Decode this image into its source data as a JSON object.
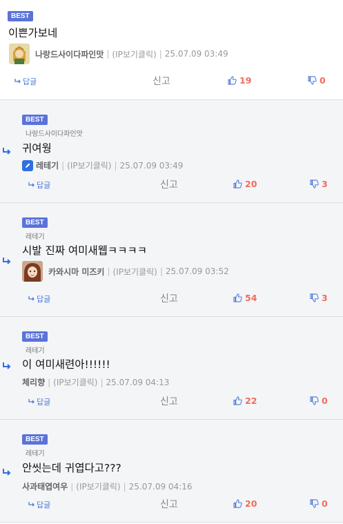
{
  "labels": {
    "badge": "BEST",
    "reply": "답글",
    "report": "신고",
    "ip": "(IP보기클릭)"
  },
  "comments": [
    {
      "body": "이쁜가보네",
      "nick": "나랑드사이다파인맛",
      "date": "25.07.09 03:49",
      "likes": "19",
      "dislikes": "0"
    },
    {
      "reply_to": "나랑드사이다파인맛",
      "body": "귀여웡",
      "nick": "레테기",
      "date": "25.07.09 03:49",
      "likes": "20",
      "dislikes": "3"
    },
    {
      "reply_to": "레테기",
      "body": "시발 진짜 여미새웹ㅋㅋㅋㅋ",
      "nick": "카와시마 미즈키",
      "date": "25.07.09 03:52",
      "likes": "54",
      "dislikes": "3"
    },
    {
      "reply_to": "레테기",
      "body": "이 여미새련아!!!!!!",
      "nick": "체리향",
      "date": "25.07.09 04:13",
      "likes": "22",
      "dislikes": "0"
    },
    {
      "reply_to": "레테기",
      "body": "안씻는데 귀엽다고???",
      "nick": "사과태엽여우",
      "date": "25.07.09 04:16",
      "likes": "20",
      "dislikes": "0"
    }
  ],
  "colors": {
    "badge": "#5b73d9",
    "accent_blue": "#4a78d8",
    "count_red": "#f26b5b"
  }
}
